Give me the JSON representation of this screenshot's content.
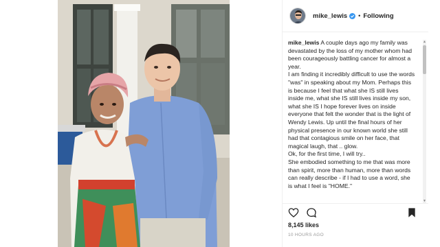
{
  "post": {
    "username": "mike_lewis",
    "follow_state": "Following",
    "separator": "•",
    "icons": {
      "verified": "verified-badge-icon",
      "like": "heart-icon",
      "comment": "comment-bubble-icon",
      "save": "bookmark-icon"
    },
    "accent_color": "#3897f0",
    "caption_lines": [
      "A couple days ago my family was devastated by the loss of my mother whom had been courageously battling cancer for almost a year.",
      "I am finding it incredibly difficult to use the words \"was\" in speaking about my Mom. Perhaps this is because I feel that what she IS still lives inside me, what she IS still lives inside my son, what she IS I hope forever lives on inside everyone that felt the wonder that is the light of Wendy Lewis. Up until the final hours of her physical presence in our known world she still had that contagious smile on her face, that magical laugh, that .. glow.",
      "Ok, for the first time, I will try..",
      "She embodied something to me that was more than spirit, more than human, more than words can really describe - if I had to use a word, she is what I feel is \"HOME.\""
    ],
    "likes": "8,145 likes",
    "time_ago": "10 HOURS AGO"
  }
}
